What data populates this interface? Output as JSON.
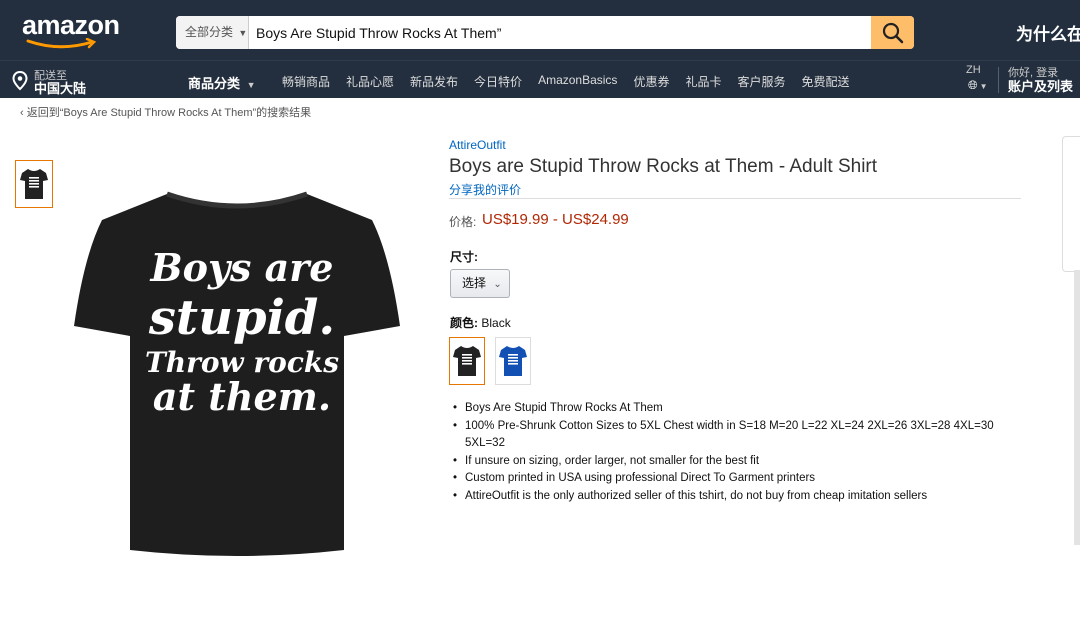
{
  "header": {
    "logo": "amazon",
    "search": {
      "category": "全部分类",
      "value": "Boys Are Stupid Throw Rocks At Them”"
    },
    "promo": "为什么在"
  },
  "nav": {
    "deliver_small": "配送至",
    "deliver_big": "中国大陆",
    "categories": "商品分类",
    "links": [
      "畅销商品",
      "礼品心愿",
      "新品发布",
      "今日特价",
      "AmazonBasics",
      "优惠券",
      "礼品卡",
      "客户服务",
      "免费配送"
    ],
    "lang": "ZH",
    "account_small": "你好, 登录",
    "account_big": "账户及列表"
  },
  "breadcrumb": "‹ 返回到“Boys Are Stupid Throw Rocks At Them”的搜索结果",
  "product": {
    "brand": "AttireOutfit",
    "title": "Boys are Stupid Throw Rocks at Them - Adult Shirt",
    "review_link": "分享我的评价",
    "price_label": "价格:",
    "price": "US$19.99 - US$24.99",
    "size_label": "尺寸:",
    "size_select": "选择",
    "color_label": "颜色:",
    "color_value": "Black",
    "shirt_text": [
      "Boys are",
      "stupid.",
      "Throw rocks",
      "at them."
    ],
    "swatch_colors": [
      "#222222",
      "#1350b4"
    ],
    "bullets": [
      "Boys Are Stupid Throw Rocks At Them",
      "100% Pre-Shrunk Cotton Sizes to 5XL Chest width in S=18 M=20 L=22 XL=24 2XL=26 3XL=28 4XL=30 5XL=32",
      "If unsure on sizing, order larger, not smaller for the best fit",
      "Custom printed in USA using professional Direct To Garment printers",
      "AttireOutfit is the only authorized seller of this tshirt, do not buy from cheap imitation sellers"
    ]
  }
}
